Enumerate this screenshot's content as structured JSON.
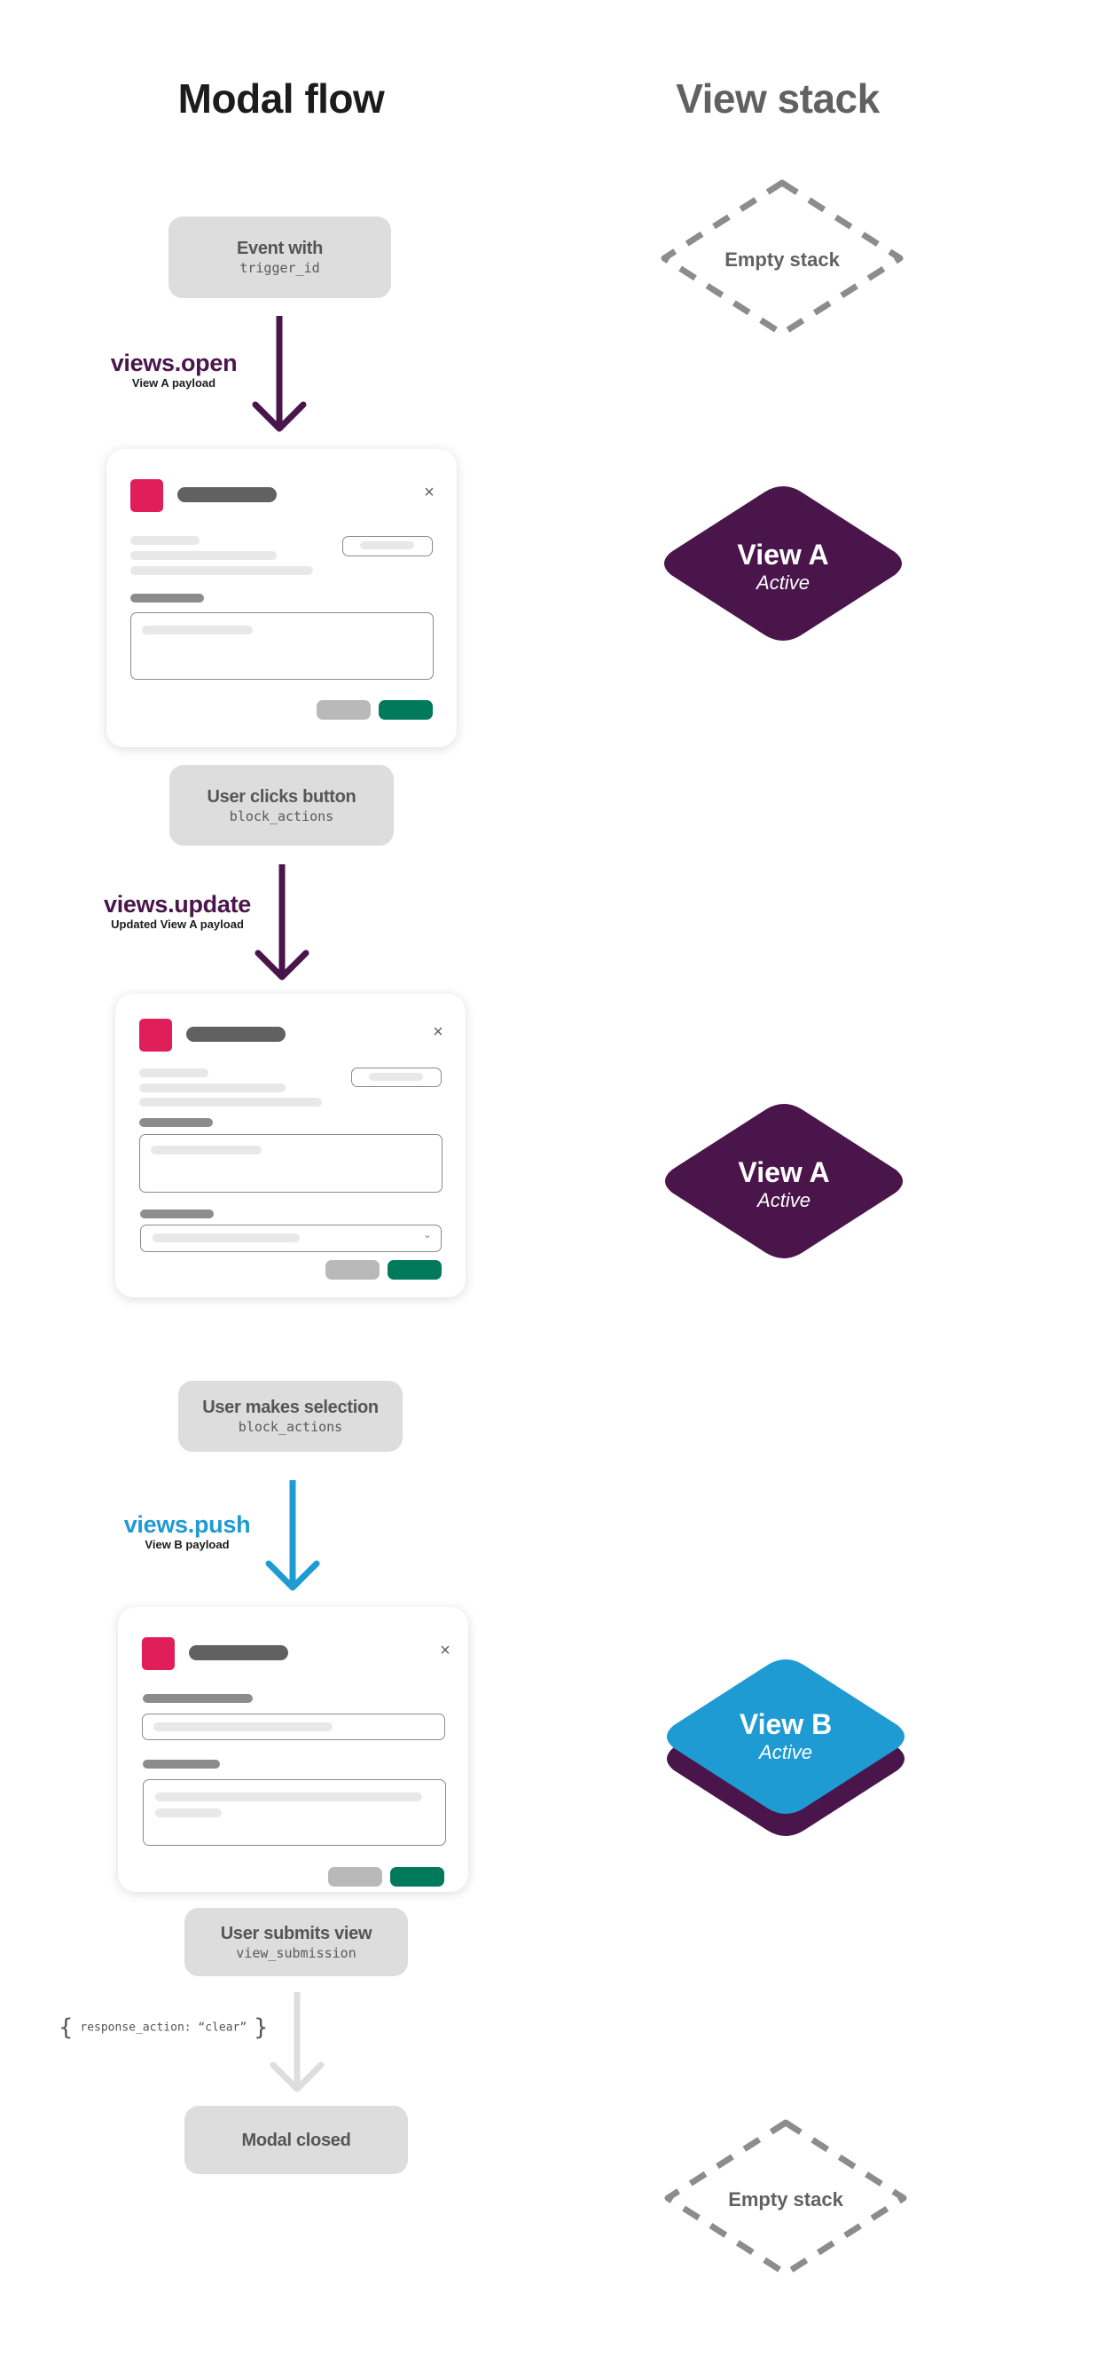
{
  "headings": {
    "modal_flow": "Modal flow",
    "view_stack": "View stack"
  },
  "colors": {
    "slack_purple": "#4a154b",
    "slack_blue": "#1e9bd3",
    "slack_green": "#007a5a",
    "slack_red": "#e01e5a",
    "neutral_gray": "#dddddd",
    "dashed_gray": "#8c8c8c"
  },
  "flow": {
    "events": [
      {
        "title": "Event with",
        "code": "trigger_id"
      },
      {
        "title": "User clicks button",
        "code": "block_actions"
      },
      {
        "title": "User makes selection",
        "code": "block_actions"
      },
      {
        "title": "User submits view",
        "code": "view_submission"
      },
      {
        "title": "Modal closed",
        "code": ""
      }
    ],
    "api_calls": [
      {
        "method": "views.open",
        "payload": "View A payload",
        "color": "#4a154b"
      },
      {
        "method": "views.update",
        "payload": "Updated View A payload",
        "color": "#4a154b"
      },
      {
        "method": "views.push",
        "payload": "View B payload",
        "color": "#1e9bd3"
      }
    ],
    "response_action": {
      "open_brace": "{",
      "text": "response_action: “clear”",
      "close_brace": "}"
    },
    "modals": [
      {
        "name": "View A",
        "close_icon": "×"
      },
      {
        "name": "View A (updated)",
        "close_icon": "×",
        "select_chevron": "⌄"
      },
      {
        "name": "View B",
        "close_icon": "×"
      }
    ]
  },
  "stack": {
    "states": [
      {
        "label": "Empty stack",
        "type": "empty"
      },
      {
        "label": "View A",
        "status": "Active",
        "type": "single"
      },
      {
        "label": "View A",
        "status": "Active",
        "type": "single"
      },
      {
        "label": "View B",
        "status": "Active",
        "type": "stacked"
      },
      {
        "label": "Empty stack",
        "type": "empty"
      }
    ]
  }
}
